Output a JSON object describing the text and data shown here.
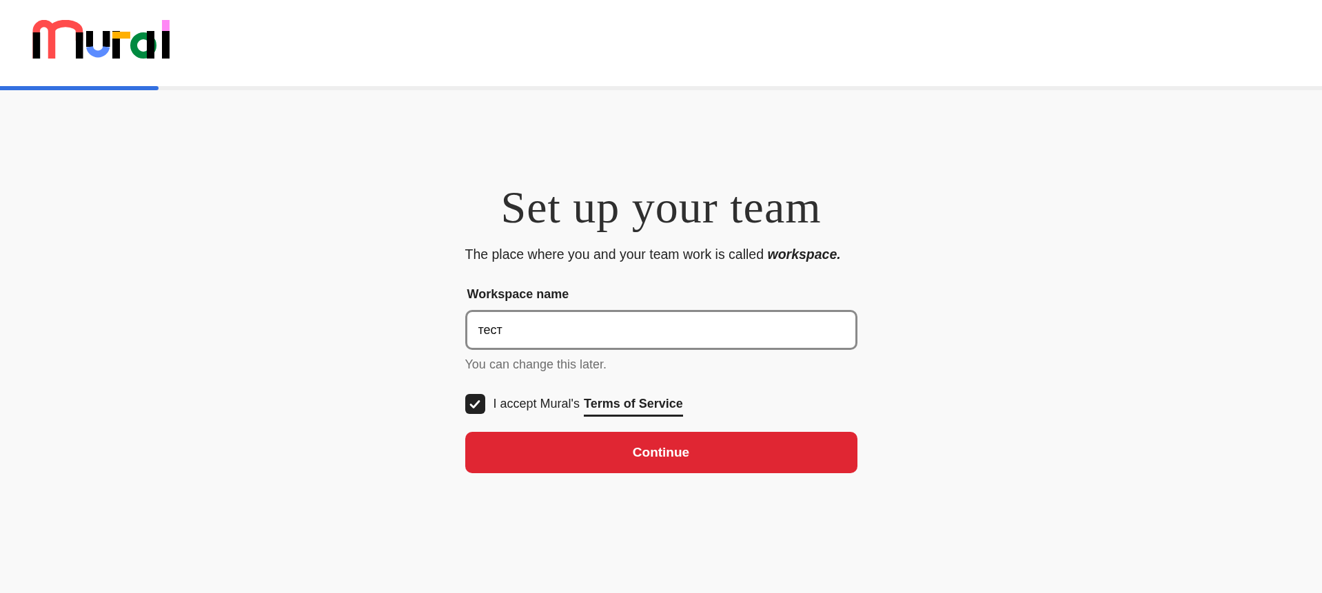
{
  "progress": {
    "level": 0.12
  },
  "title": "Set up your team",
  "intro": "The place where you and your team work is called **workspace.**",
  "field": {
    "label": "Workspace name",
    "value": "тест",
    "hint": "You can change this later."
  },
  "terms": {
    "checked": true,
    "text": "I accept Mural's",
    "link": "Terms of Service"
  },
  "button": "Continue"
}
